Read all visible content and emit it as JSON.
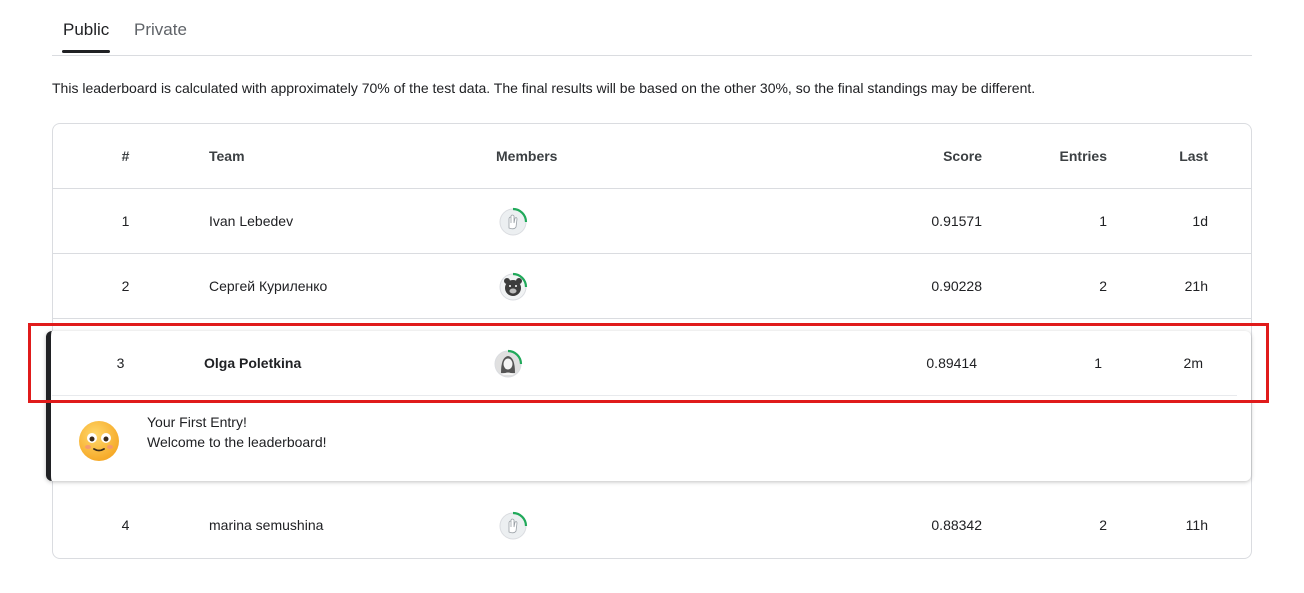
{
  "tabs": [
    {
      "label": "Public",
      "active": true
    },
    {
      "label": "Private",
      "active": false
    }
  ],
  "notice": "This leaderboard is calculated with approximately 70% of the test data. The final results will be based on the other 30%, so the final standings may be different.",
  "table": {
    "headers": {
      "rank": "#",
      "team": "Team",
      "members": "Members",
      "score": "Score",
      "entries": "Entries",
      "last": "Last"
    },
    "rows": [
      {
        "rank": "1",
        "team": "Ivan Lebedev",
        "avatar": "hand-avatar-icon",
        "score": "0.91571",
        "entries": "1",
        "last": "1d"
      },
      {
        "rank": "2",
        "team": "Сергей Куриленко",
        "avatar": "bear-avatar-icon",
        "score": "0.90228",
        "entries": "2",
        "last": "21h"
      },
      {
        "rank": "3",
        "team": "Olga Poletkina",
        "avatar": "woman-avatar-icon",
        "score": "0.89414",
        "entries": "1",
        "last": "2m"
      },
      {
        "rank": "4",
        "team": "marina semushina",
        "avatar": "hand-avatar-icon",
        "score": "0.88342",
        "entries": "2",
        "last": "11h"
      }
    ]
  },
  "highlight": {
    "message_line1": "Your First Entry!",
    "message_line2": "Welcome to the leaderboard!",
    "emoji": "smiley-face-icon"
  },
  "colors": {
    "progress_ring": "#20a95a",
    "highlight_box": "#e01b1b",
    "text": "#202124"
  }
}
